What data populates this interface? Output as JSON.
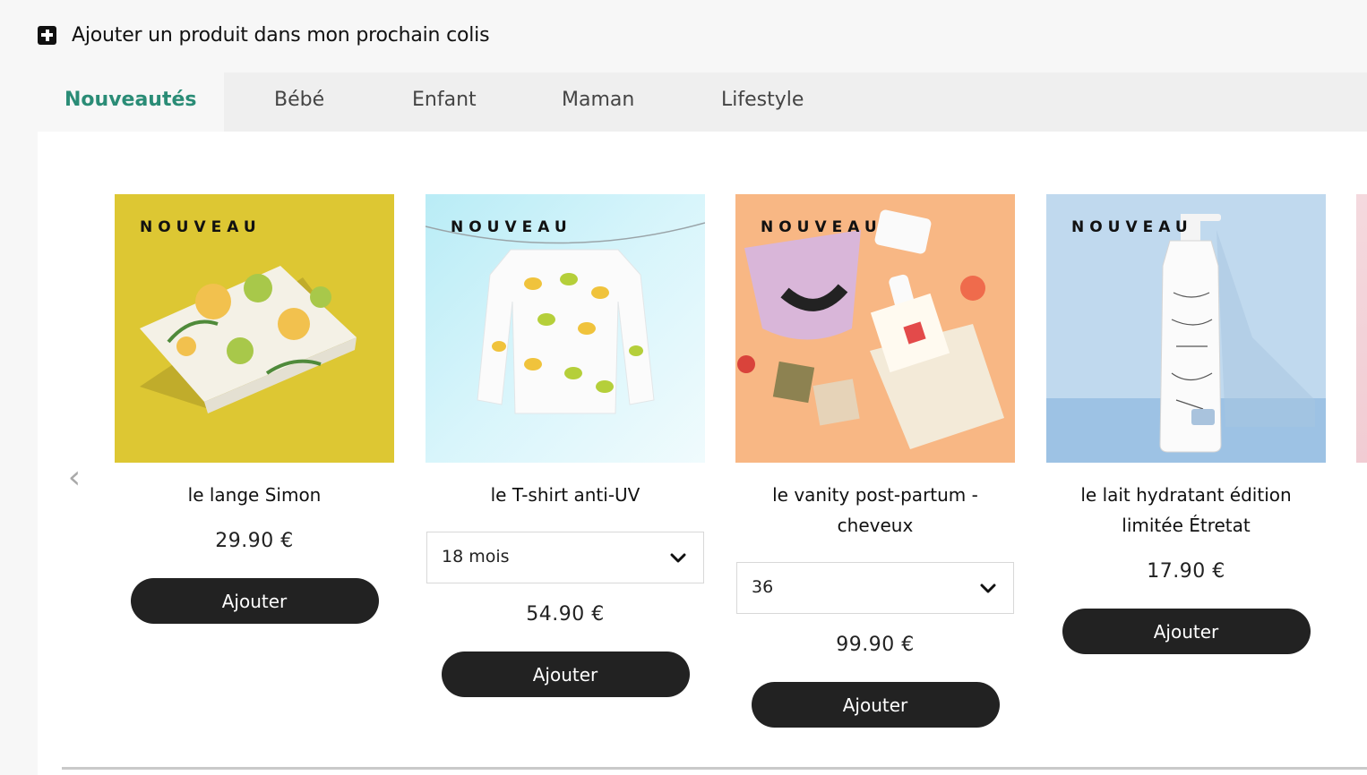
{
  "header": {
    "title": "Ajouter un produit dans mon prochain colis"
  },
  "tabs": [
    {
      "label": "Nouveautés",
      "active": true
    },
    {
      "label": "Bébé",
      "active": false
    },
    {
      "label": "Enfant",
      "active": false
    },
    {
      "label": "Maman",
      "active": false
    },
    {
      "label": "Lifestyle",
      "active": false
    }
  ],
  "products": [
    {
      "badge": "NOUVEAU",
      "name": "le lange Simon",
      "price": "29.90 €",
      "button": "Ajouter"
    },
    {
      "badge": "NOUVEAU",
      "name": "le T-shirt anti-UV",
      "size": "18 mois",
      "price": "54.90 €",
      "button": "Ajouter"
    },
    {
      "badge": "NOUVEAU",
      "name": "le vanity post-partum - cheveux",
      "size": "36",
      "price": "99.90 €",
      "button": "Ajouter"
    },
    {
      "badge": "NOUVEAU",
      "name": "le lait hydratant édition limitée Étretat",
      "price": "17.90 €",
      "button": "Ajouter"
    }
  ],
  "icons": {
    "add": "plus-square-icon",
    "prev": "chevron-left-icon",
    "dropdown": "chevron-down-icon"
  },
  "colors": {
    "accent": "#2a8c76",
    "button": "#222222"
  }
}
